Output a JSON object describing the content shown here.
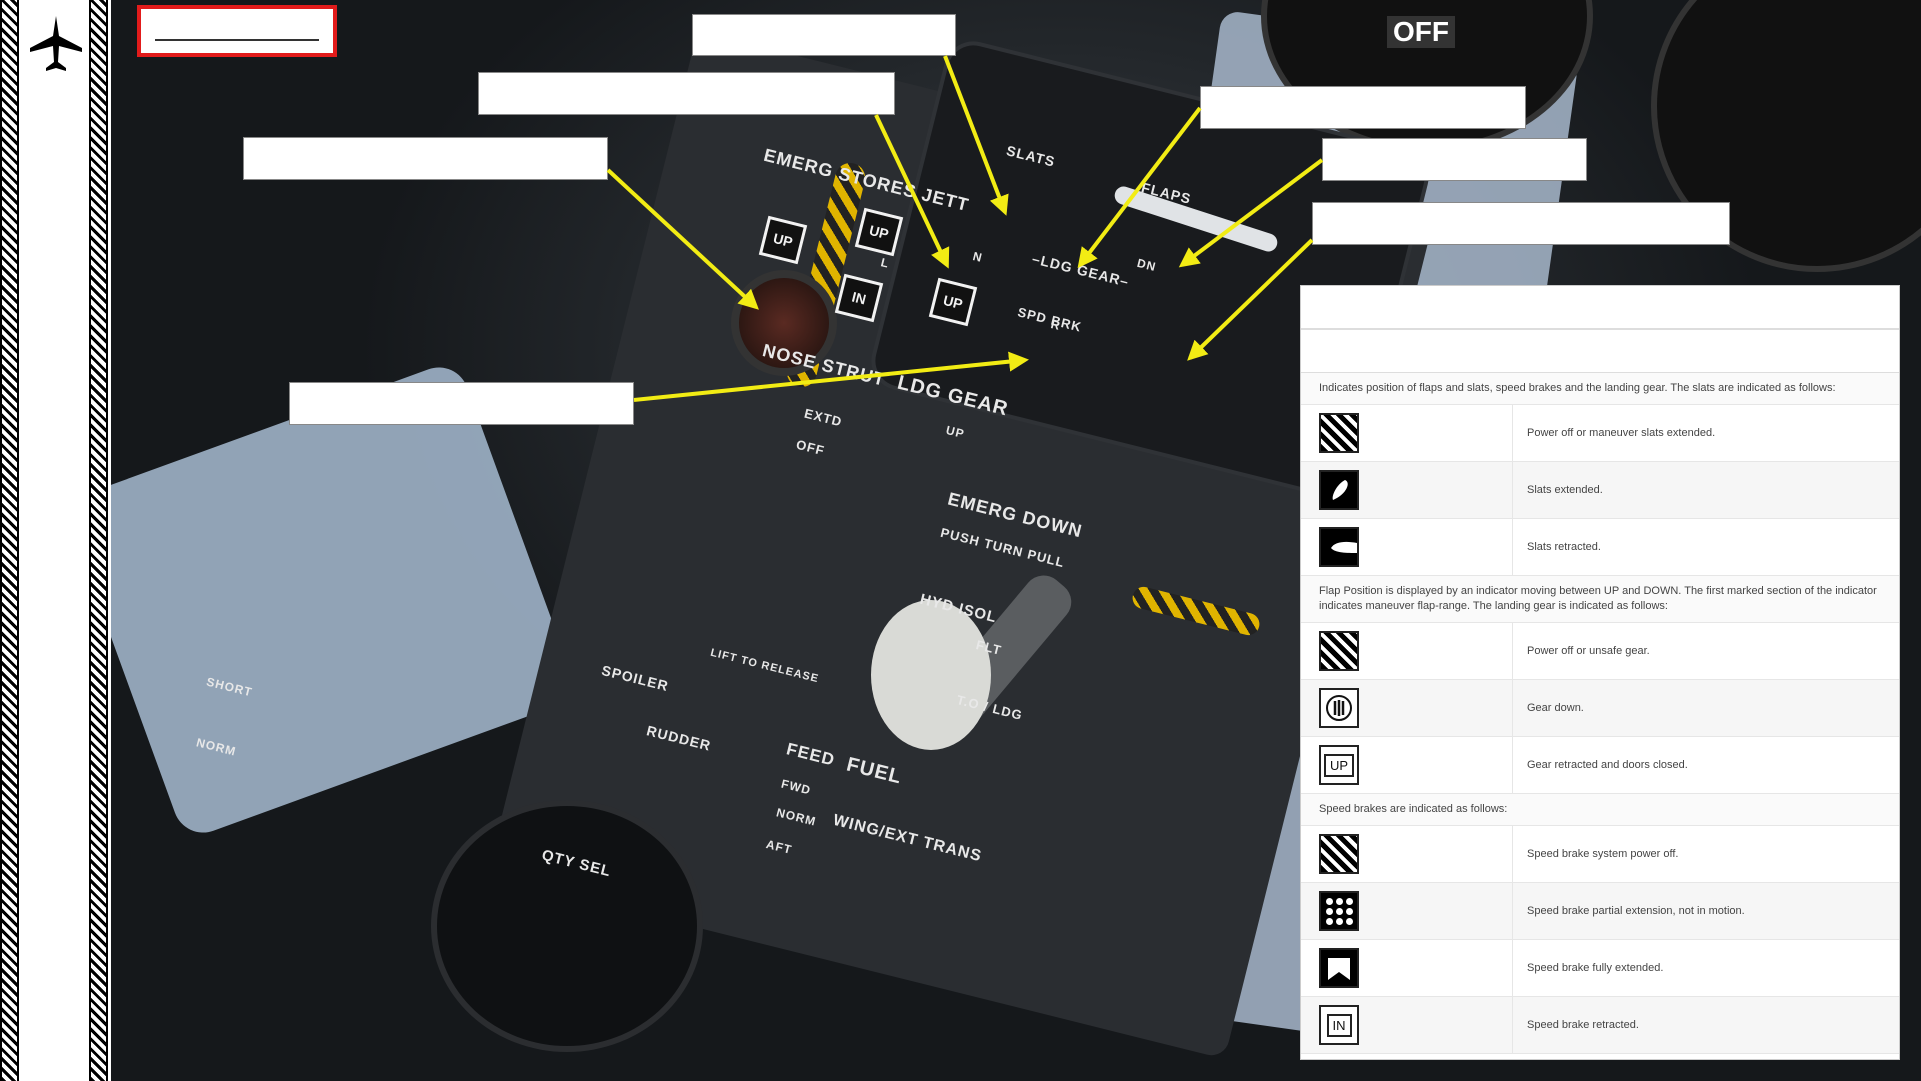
{
  "panel_labels": {
    "emerg_stores_jett": "EMERG STORES JETT",
    "slats": "SLATS",
    "flaps": "FLAPS",
    "ldg_gear": "–LDG GEAR–",
    "spd_brk": "SPD BRK",
    "dn": "DN",
    "l": "L",
    "n": "N",
    "r": "R",
    "nose_strut": "NOSE STRUT",
    "extd": "EXTD",
    "off": "OFF",
    "ldg_gear_handle": "LDG GEAR",
    "up": "UP",
    "emerg_down": "EMERG DOWN",
    "push_turn_pull": "PUSH TURN PULL",
    "hyd_isol": "HYD ISOL",
    "flt": "FLT",
    "to_ldg": "T.O / LDG",
    "lift_to_release": "LIFT TO RELEASE",
    "spoiler": "SPOILER",
    "rudder": "RUDDER",
    "feed": "FEED",
    "fuel": "FUEL",
    "fwd": "FWD",
    "norm": "NORM",
    "aft": "AFT",
    "wing_ext_trans": "WING/EXT TRANS",
    "qty_sel": "QTY SEL",
    "gauge_off": "OFF",
    "short": "SHORT"
  },
  "indicators": {
    "left_gear": "UP",
    "nose_gear": "UP",
    "right_gear": "UP",
    "speed_brake": "IN"
  },
  "legend": {
    "intro": "Indicates position of flaps and slats, speed brakes and the landing gear. The slats are indicated as follows:",
    "slat_rows": [
      {
        "icon": "hatched-square-icon",
        "text": "Power off or maneuver slats extended."
      },
      {
        "icon": "slat-extended-icon",
        "text": "Slats extended."
      },
      {
        "icon": "slat-retracted-icon",
        "text": "Slats retracted."
      }
    ],
    "flap_note": "Flap Position is displayed by an indicator moving between UP and DOWN. The first marked section of the indicator indicates maneuver flap-range. The landing gear is indicated as follows:",
    "gear_rows": [
      {
        "icon": "hatched-square-icon",
        "text": "Power off or unsafe gear."
      },
      {
        "icon": "gear-down-icon",
        "text": "Gear down."
      },
      {
        "icon": "gear-up-icon",
        "label": "UP",
        "text": "Gear retracted and doors closed."
      }
    ],
    "speedbrake_note": "Speed brakes are indicated as follows:",
    "speedbrake_rows": [
      {
        "icon": "hatched-square-icon",
        "text": "Speed brake system power off."
      },
      {
        "icon": "dotted-square-icon",
        "text": "Speed brake partial extension, not in motion."
      },
      {
        "icon": "speedbrake-extended-icon",
        "text": "Speed brake fully extended."
      },
      {
        "icon": "speedbrake-retracted-icon",
        "label": "IN",
        "text": "Speed brake retracted."
      }
    ]
  },
  "colors": {
    "accent_red": "#e21b1b",
    "arrow_yellow": "#f2ec14"
  }
}
